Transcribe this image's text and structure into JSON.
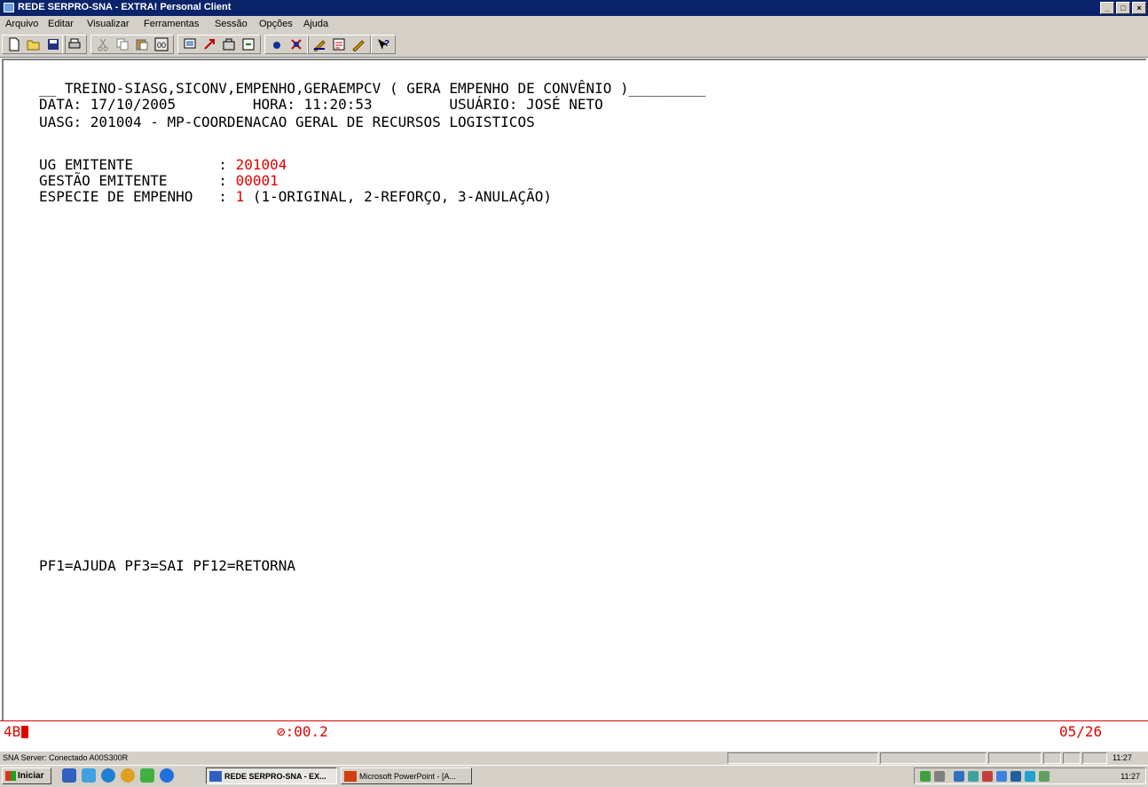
{
  "window": {
    "title": "REDE SERPRO-SNA - EXTRA! Personal Client",
    "buttons": [
      "_",
      "□",
      "×"
    ]
  },
  "menu": [
    "Arquivo",
    "Editar",
    "Visualizar",
    "Ferramentas",
    "Sessão",
    "Opções",
    "Ajuda"
  ],
  "toolbar": {
    "icons": [
      "new-icon",
      "open-icon",
      "save-icon",
      "print-icon",
      "cut-icon",
      "copy-icon",
      "paste-icon",
      "quickpad-icon",
      "screen-icon",
      "macro-icon",
      "hotspot-icon",
      "transfer-icon",
      "record-icon",
      "stop-icon",
      "edit-icon",
      "settings-icon",
      "edit2-icon",
      "help-icon"
    ]
  },
  "terminal": {
    "header_line": "__ TREINO-SIASG,SICONV,EMPENHO,GERAEMPCV ( GERA EMPENHO DE CONVÊNIO )_________",
    "date_line": "DATA: 17/10/2005         HORA: 11:20:53         USUÁRIO: JOSÉ NETO",
    "uasg_line": "UASG: 201004 - MP-COORDENACAO GERAL DE RECURSOS LOGISTICOS",
    "fields": [
      {
        "label": "UG EMITENTE          : ",
        "value": "201004",
        "suffix": ""
      },
      {
        "label": "GESTÃO EMITENTE      : ",
        "value": "00001",
        "suffix": ""
      },
      {
        "label": "ESPECIE DE EMPENHO   : ",
        "value": "1",
        "suffix": " (1-ORIGINAL, 2-REFORÇO, 3-ANULAÇÃO)"
      }
    ],
    "pf_keys": "PF1=AJUDA PF3=SAI PF12=RETORNA"
  },
  "oia": {
    "indicator": "4B",
    "clock": "⊘:00.2",
    "cursor_position": "05/26"
  },
  "status": {
    "text": "SNA Server: Conectado A00S300R",
    "time": "11:27"
  },
  "taskbar": {
    "start_label": "Iniciar",
    "tasks": [
      "REDE SERPRO-SNA - EX...",
      "Microsoft PowerPoint - [A..."
    ],
    "clock": "11:27"
  }
}
